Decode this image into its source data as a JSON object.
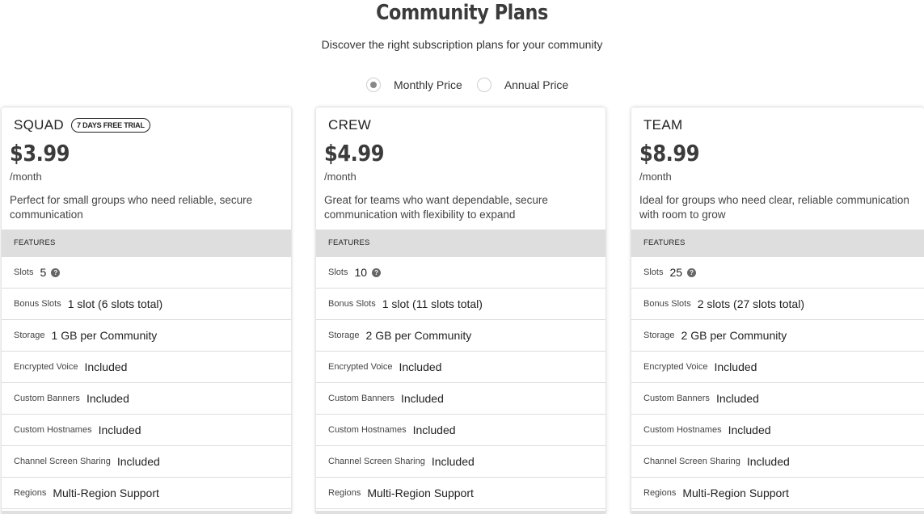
{
  "page": {
    "title": "Community Plans",
    "subtitle": "Discover the right subscription plans for your community"
  },
  "billing_toggle": {
    "options": [
      {
        "label": "Monthly Price",
        "selected": true
      },
      {
        "label": "Annual Price",
        "selected": false
      }
    ]
  },
  "plans": [
    {
      "name": "SQUAD",
      "badge": "7 DAYS FREE TRIAL",
      "price": "$3.99",
      "period": "/month",
      "description": "Perfect for small groups who need reliable, secure communication",
      "features_header": "FEATURES",
      "features": [
        {
          "label": "Slots",
          "value": "5",
          "help_icon": "question-circle-icon"
        },
        {
          "label": "Bonus Slots",
          "value": "1 slot (6 slots total)"
        },
        {
          "label": "Storage",
          "value": "1 GB per Community"
        },
        {
          "label": "Encrypted Voice",
          "value": "Included"
        },
        {
          "label": "Custom Banners",
          "value": "Included"
        },
        {
          "label": "Custom Hostnames",
          "value": "Included"
        },
        {
          "label": "Channel Screen Sharing",
          "value": "Included"
        },
        {
          "label": "Regions",
          "value": "Multi-Region Support"
        }
      ]
    },
    {
      "name": "CREW",
      "badge": "",
      "price": "$4.99",
      "period": "/month",
      "description": "Great for teams who want dependable, secure communication with flexibility to expand",
      "features_header": "FEATURES",
      "features": [
        {
          "label": "Slots",
          "value": "10",
          "help_icon": "question-circle-icon"
        },
        {
          "label": "Bonus Slots",
          "value": "1 slot (11 slots total)"
        },
        {
          "label": "Storage",
          "value": "2 GB per Community"
        },
        {
          "label": "Encrypted Voice",
          "value": "Included"
        },
        {
          "label": "Custom Banners",
          "value": "Included"
        },
        {
          "label": "Custom Hostnames",
          "value": "Included"
        },
        {
          "label": "Channel Screen Sharing",
          "value": "Included"
        },
        {
          "label": "Regions",
          "value": "Multi-Region Support"
        }
      ]
    },
    {
      "name": "TEAM",
      "badge": "",
      "price": "$8.99",
      "period": "/month",
      "description": "Ideal for groups who need clear, reliable communication with room to grow",
      "features_header": "FEATURES",
      "features": [
        {
          "label": "Slots",
          "value": "25",
          "help_icon": "question-circle-icon"
        },
        {
          "label": "Bonus Slots",
          "value": "2 slots (27 slots total)"
        },
        {
          "label": "Storage",
          "value": "2 GB per Community"
        },
        {
          "label": "Encrypted Voice",
          "value": "Included"
        },
        {
          "label": "Custom Banners",
          "value": "Included"
        },
        {
          "label": "Custom Hostnames",
          "value": "Included"
        },
        {
          "label": "Channel Screen Sharing",
          "value": "Included"
        },
        {
          "label": "Regions",
          "value": "Multi-Region Support"
        }
      ]
    }
  ],
  "colors": {
    "features_header_bg": "#dedede",
    "title": "#3b3b3b",
    "radio_selected": "#888888"
  }
}
